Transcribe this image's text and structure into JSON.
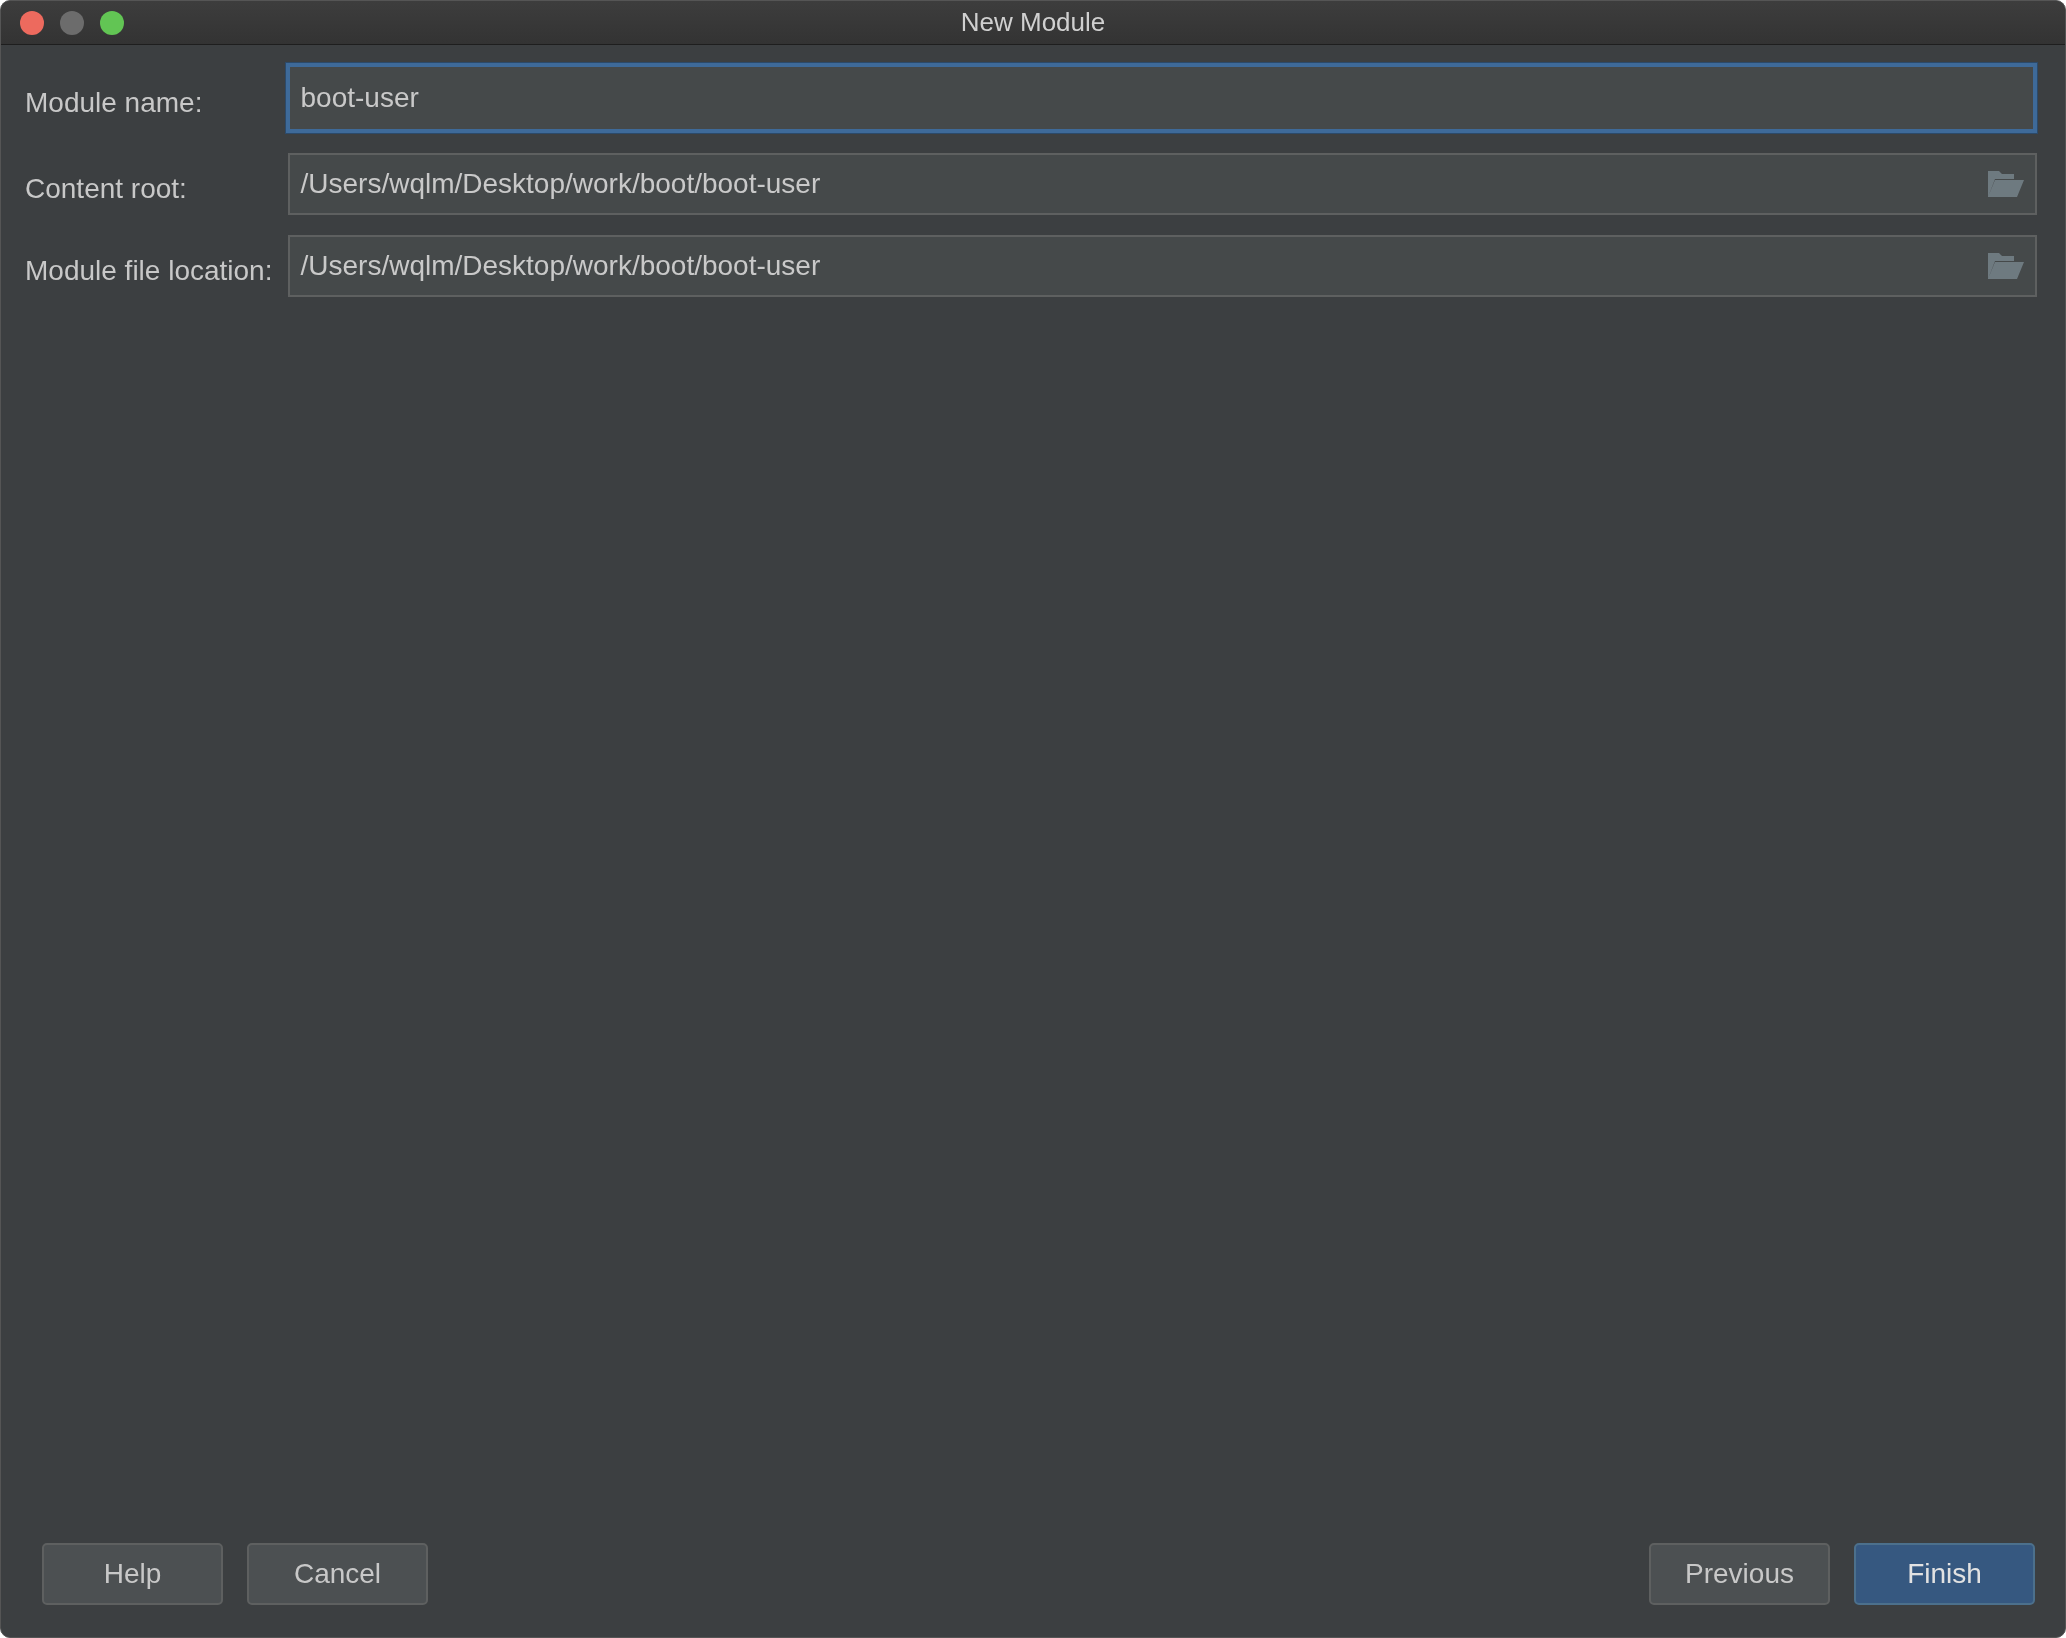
{
  "window": {
    "title": "New Module"
  },
  "fields": [
    {
      "label": "Module name:",
      "value": "boot-user",
      "focused": true,
      "browse": false
    },
    {
      "label": "Content root:",
      "value": "/Users/wqlm/Desktop/work/boot/boot-user",
      "focused": false,
      "browse": true
    },
    {
      "label": "Module file location:",
      "value": "/Users/wqlm/Desktop/work/boot/boot-user",
      "focused": false,
      "browse": true
    }
  ],
  "buttons_left": [
    {
      "label": "Help",
      "default": false
    },
    {
      "label": "Cancel",
      "default": false
    }
  ],
  "buttons_right": [
    {
      "label": "Previous",
      "default": false
    },
    {
      "label": "Finish",
      "default": true
    }
  ]
}
